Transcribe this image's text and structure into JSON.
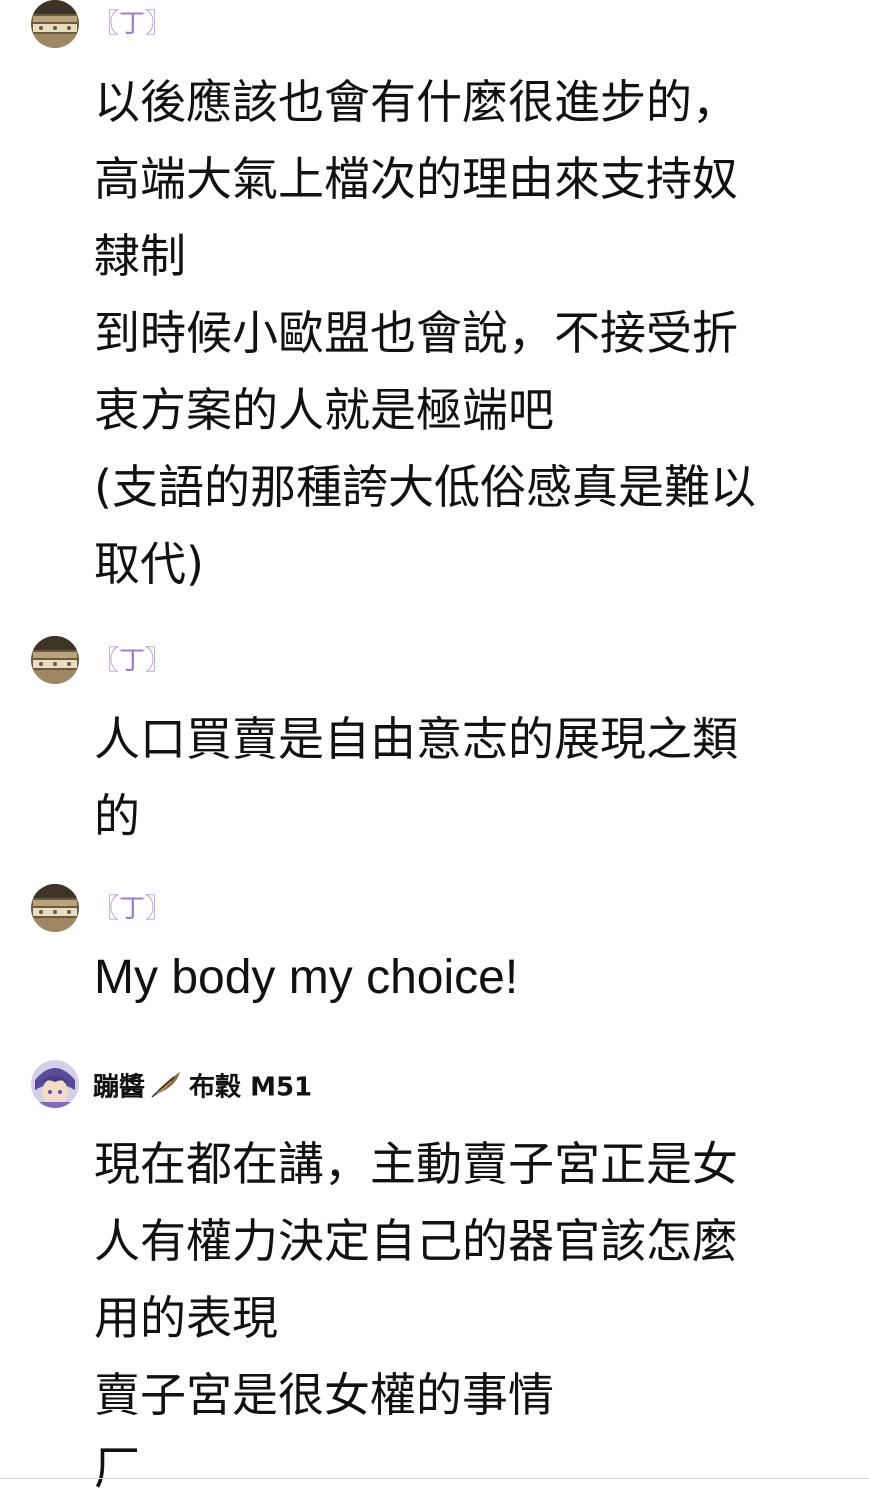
{
  "colors": {
    "author_tag": "#9b7fc7",
    "text": "#111111",
    "divider": "#d9d9d9"
  },
  "messages": [
    {
      "author": "〖丁〗",
      "avatar": "chest-drawer-avatar-icon",
      "lines": [
        "以後應該也會有什麼很進步的，",
        "高端大氣上檔次的理由來支持奴",
        "隸制",
        "到時候小歐盟也會說，不接受折",
        "衷方案的人就是極端吧",
        "(支語的那種誇大低俗感真是難以",
        "取代)"
      ]
    },
    {
      "author": "〖丁〗",
      "avatar": "chest-drawer-avatar-icon",
      "lines": [
        "人口買賣是自由意志的展現之類",
        "的"
      ]
    },
    {
      "author": "〖丁〗",
      "avatar": "chest-drawer-avatar-icon",
      "lines": [
        "My body my choice!"
      ]
    },
    {
      "author": "蹦醬",
      "author_suffix": "布穀 M51",
      "avatar": "anime-character-avatar-icon",
      "author_icon": "feather-icon",
      "lines": [
        "現在都在講，主動賣子宮正是女",
        "人有權力決定自己的器官該怎麼",
        "用的表現",
        "賣子宮是很女權的事情",
        "厂"
      ]
    }
  ]
}
